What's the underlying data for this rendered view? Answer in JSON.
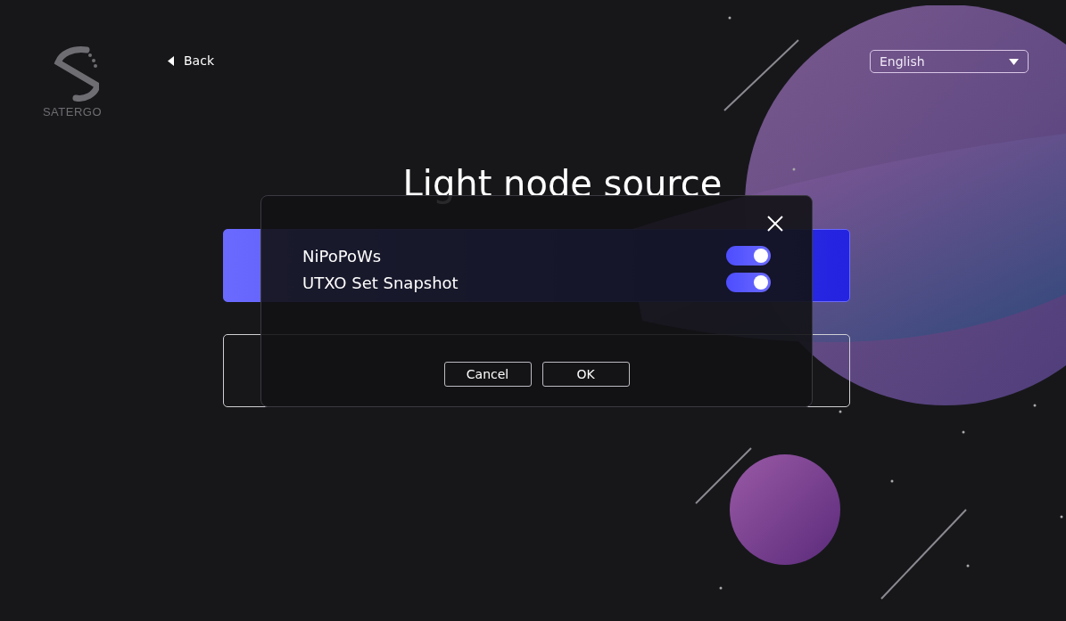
{
  "logo": {
    "text": "SATERGO"
  },
  "back": {
    "label": "Back"
  },
  "language": {
    "value": "English"
  },
  "title": "Light node source",
  "options": [
    {
      "selected": true
    },
    {
      "selected": false
    }
  ],
  "dialog": {
    "toggles": [
      {
        "label": "NiPoPoWs",
        "on": true
      },
      {
        "label": "UTXO Set Snapshot",
        "on": true
      }
    ],
    "buttons": [
      {
        "label": "Cancel"
      },
      {
        "label": "OK"
      }
    ]
  }
}
